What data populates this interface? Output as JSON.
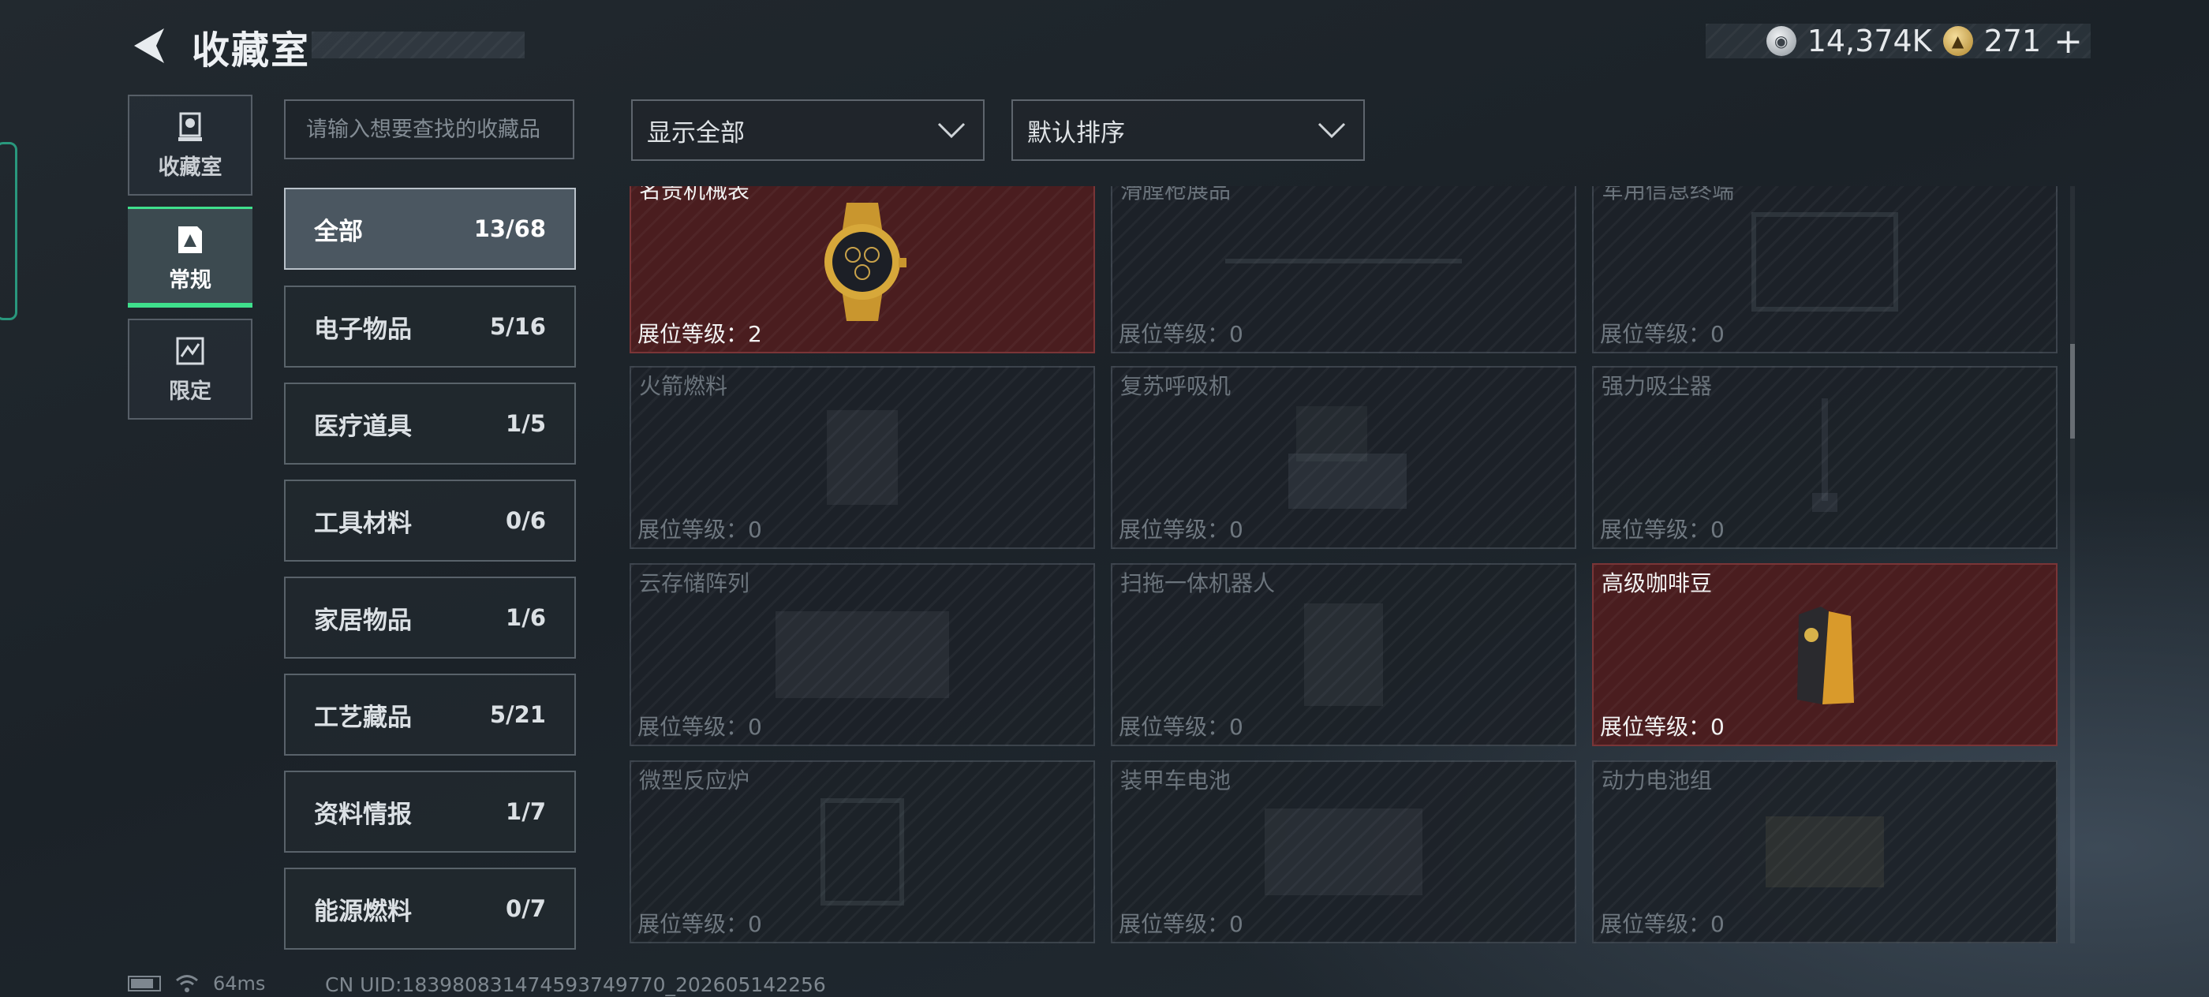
{
  "header": {
    "title": "收藏室"
  },
  "currency": {
    "silver": "14,374K",
    "gold": "271",
    "plus": "+"
  },
  "nav": [
    {
      "label": "收藏室",
      "icon": "trophy-icon",
      "active": false
    },
    {
      "label": "常规",
      "icon": "collection-icon",
      "active": true
    },
    {
      "label": "限定",
      "icon": "limited-icon",
      "active": false
    }
  ],
  "search": {
    "placeholder": "请输入想要查找的收藏品"
  },
  "filters": {
    "show": "显示全部",
    "sort": "默认排序"
  },
  "categories": [
    {
      "name": "全部",
      "count": "13/68",
      "active": true
    },
    {
      "name": "电子物品",
      "count": "5/16"
    },
    {
      "name": "医疗道具",
      "count": "1/5"
    },
    {
      "name": "工具材料",
      "count": "0/6"
    },
    {
      "name": "家居物品",
      "count": "1/6"
    },
    {
      "name": "工艺藏品",
      "count": "5/21"
    },
    {
      "name": "资料情报",
      "count": "1/7"
    },
    {
      "name": "能源燃料",
      "count": "0/7"
    }
  ],
  "items": [
    {
      "name": "名贵机械表",
      "level": "展位等级：2",
      "owned": true
    },
    {
      "name": "滑膛枪展品",
      "level": "展位等级：0",
      "owned": false
    },
    {
      "name": "军用信息终端",
      "level": "展位等级：0",
      "owned": false
    },
    {
      "name": "火箭燃料",
      "level": "展位等级：0",
      "owned": false
    },
    {
      "name": "复苏呼吸机",
      "level": "展位等级：0",
      "owned": false
    },
    {
      "name": "强力吸尘器",
      "level": "展位等级：0",
      "owned": false
    },
    {
      "name": "云存储阵列",
      "level": "展位等级：0",
      "owned": false
    },
    {
      "name": "扫拖一体机器人",
      "level": "展位等级：0",
      "owned": false
    },
    {
      "name": "高级咖啡豆",
      "level": "展位等级：0",
      "owned": true
    },
    {
      "name": "微型反应炉",
      "level": "展位等级：0",
      "owned": false
    },
    {
      "name": "装甲车电池",
      "level": "展位等级：0",
      "owned": false
    },
    {
      "name": "动力电池组",
      "level": "展位等级：0",
      "owned": false
    }
  ],
  "status": {
    "ping": "64ms",
    "uid": "CN UID:18398083147459374977​0_202605142256"
  }
}
